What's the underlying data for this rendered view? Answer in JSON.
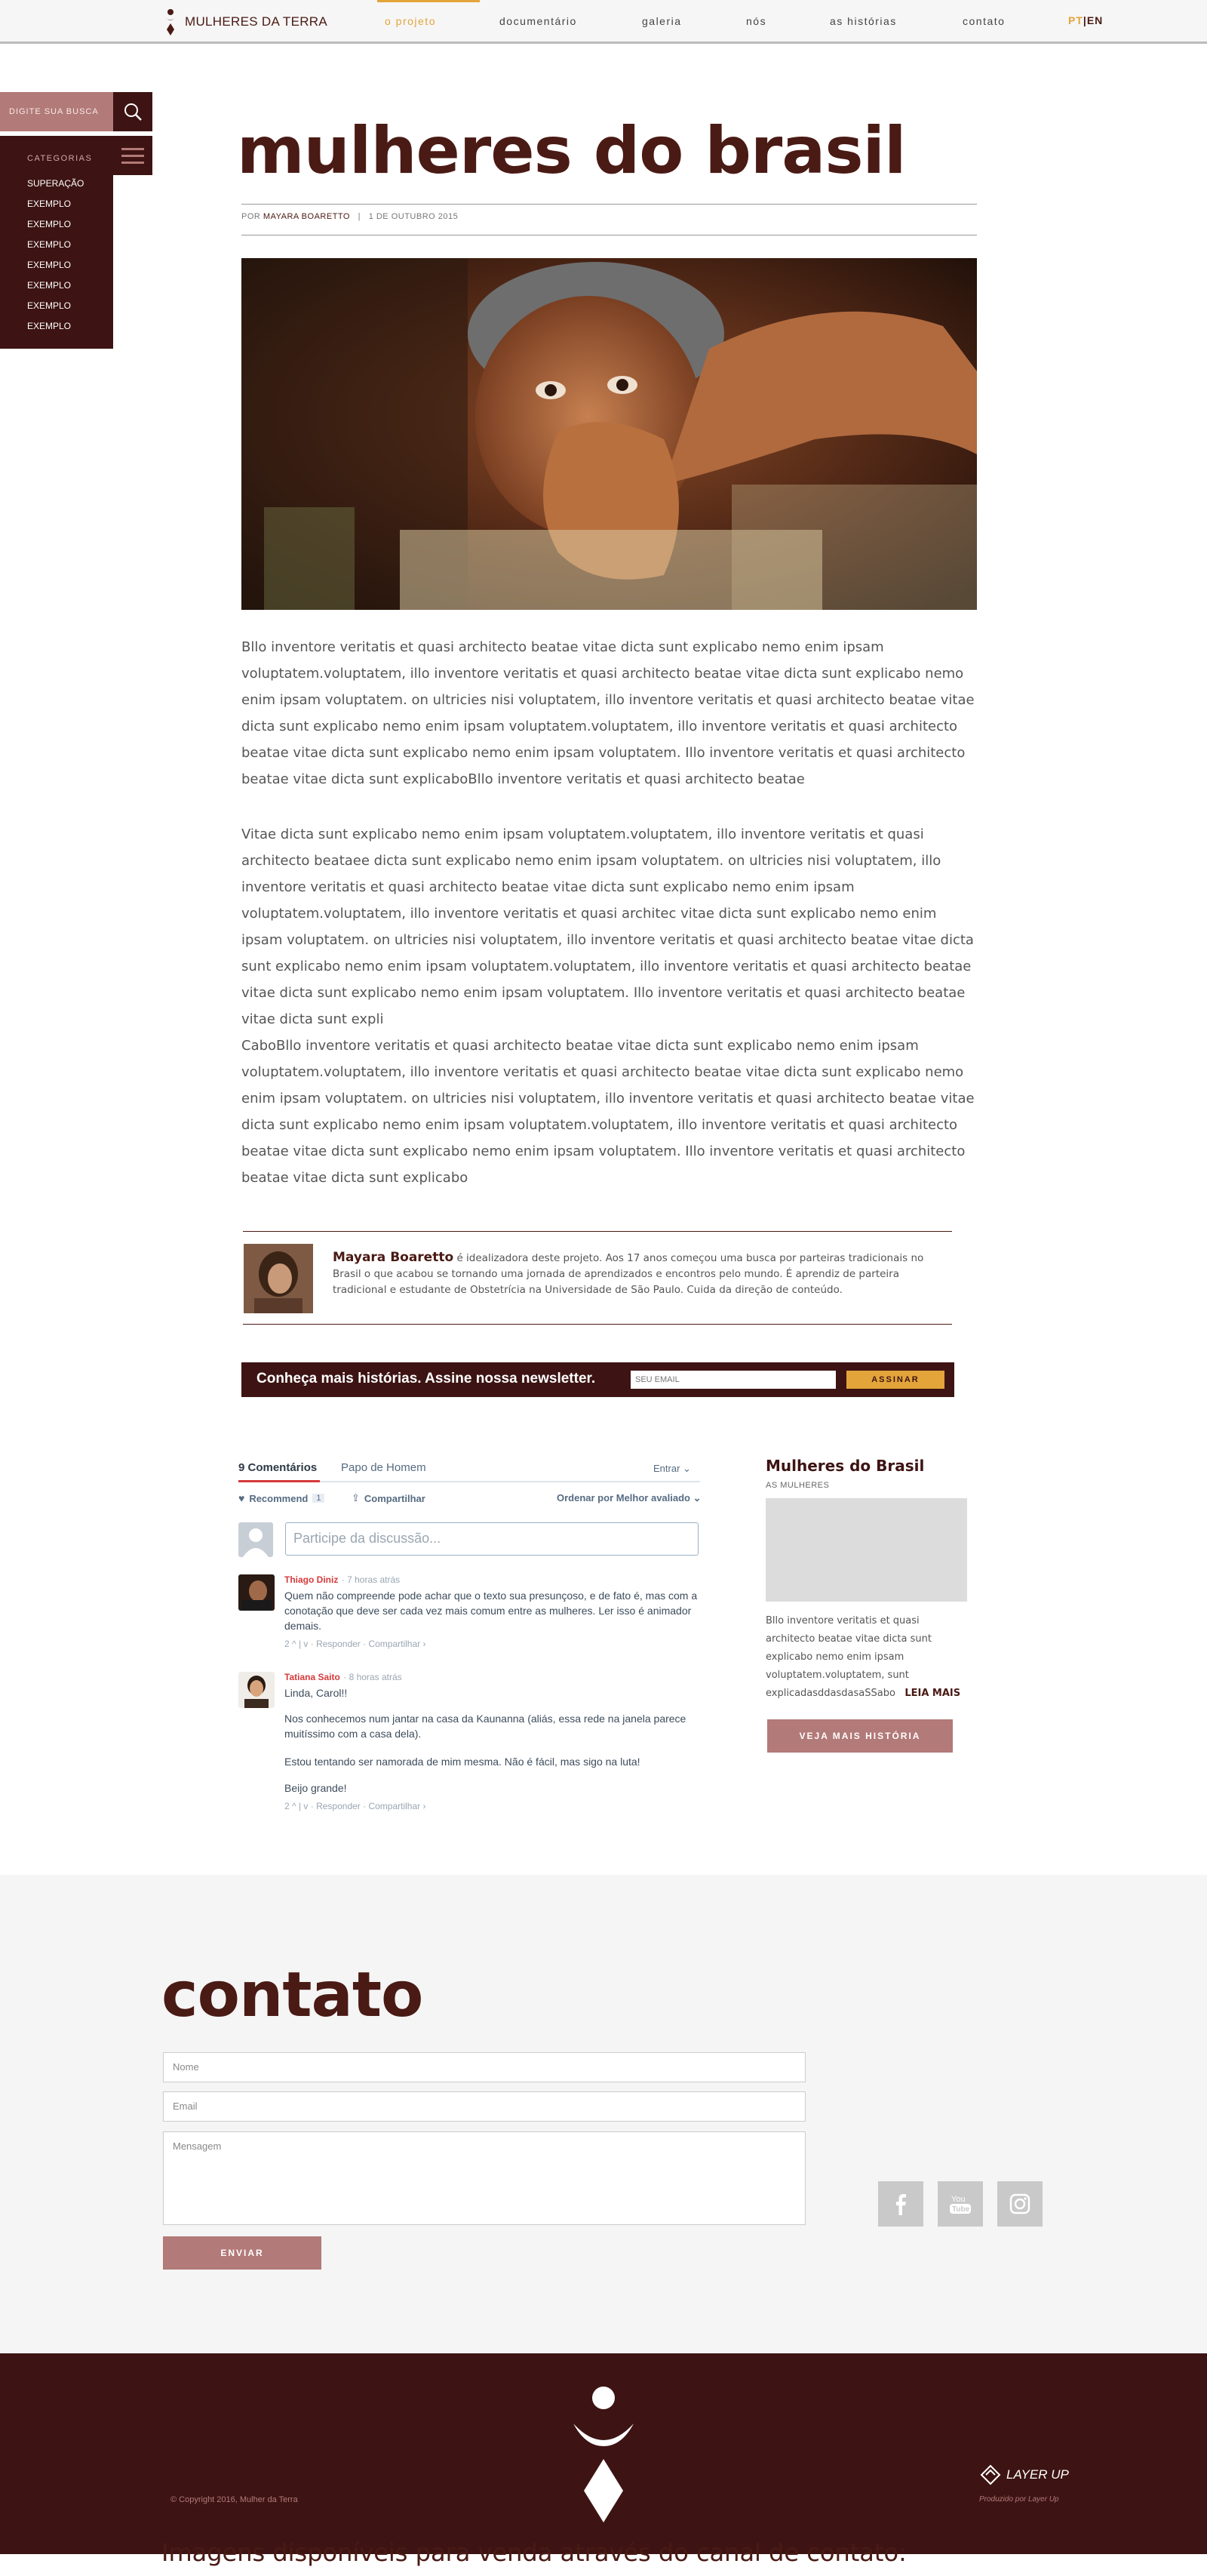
{
  "nav": {
    "logo_text": "MULHERES DA TERRA",
    "items": [
      "o projeto",
      "documentário",
      "galeria",
      "nós",
      "as histórias",
      "contato"
    ],
    "lang_pt": "PT",
    "lang_sep": "|",
    "lang_en": "EN",
    "accent_color": "#e3a43a"
  },
  "sidebar": {
    "search_placeholder": "DIGITE SUA BUSCA",
    "categories_header": "CATEGORIAS",
    "categories": [
      "SUPERAÇÃO",
      "EXEMPLO",
      "EXEMPLO",
      "EXEMPLO",
      "EXEMPLO",
      "EXEMPLO",
      "EXEMPLO",
      "EXEMPLO"
    ]
  },
  "article": {
    "title": "mulheres do brasil",
    "byline_prefix": "POR",
    "author": "MAYARA BOARETTO",
    "separator": "|",
    "date": "1 DE OUTUBRO 2015",
    "paragraphs": [
      "Bllo inventore veritatis et quasi architecto beatae vitae dicta sunt explicabo nemo enim ipsam voluptatem.voluptatem, illo inventore veritatis et quasi architecto beatae vitae dicta sunt explicabo nemo enim ipsam voluptatem. on ultricies nisi voluptatem, illo inventore veritatis et quasi architecto beatae vitae dicta sunt explicabo nemo enim ipsam voluptatem.voluptatem, illo inventore veritatis et quasi architecto beatae vitae dicta sunt explicabo nemo enim ipsam voluptatem. Illo inventore veritatis et quasi architecto beatae vitae dicta sunt explicaboBllo inventore veritatis et quasi architecto beatae",
      "Vitae dicta sunt explicabo nemo enim ipsam voluptatem.voluptatem, illo inventore veritatis et quasi architecto beataee dicta sunt explicabo nemo enim ipsam voluptatem. on ultricies nisi voluptatem, illo inventore veritatis et quasi architecto beatae vitae dicta sunt explicabo nemo enim ipsam voluptatem.voluptatem, illo inventore veritatis et quasi architec vitae dicta sunt explicabo nemo enim ipsam voluptatem. on ultricies nisi voluptatem, illo inventore veritatis et quasi architecto beatae vitae dicta sunt explicabo nemo enim ipsam voluptatem.voluptatem, illo inventore veritatis et quasi architecto beatae vitae dicta sunt explicabo nemo enim ipsam voluptatem. Illo inventore veritatis et quasi architecto beatae vitae dicta sunt expli",
      "CaboBllo inventore veritatis et quasi architecto beatae vitae dicta sunt explicabo nemo enim ipsam voluptatem.voluptatem, illo inventore veritatis et quasi architecto beatae vitae dicta sunt explicabo nemo enim ipsam voluptatem. on ultricies nisi voluptatem, illo inventore veritatis et quasi architecto beatae vitae dicta sunt explicabo nemo enim ipsam voluptatem.voluptatem, illo inventore veritatis et quasi architecto beatae vitae dicta sunt explicabo nemo enim ipsam voluptatem. Illo inventore veritatis et quasi architecto beatae vitae dicta sunt explicabo"
    ]
  },
  "author_box": {
    "name": "Mayara Boaretto",
    "bio": " é idealizadora deste projeto. Aos 17 anos começou uma busca por parteiras tradicionais no Brasil o que acabou se tornando uma jornada de aprendizados e encontros pelo mundo. É aprendiz de parteira tradicional e estudante de Obstetrícia na Universidade de São Paulo. Cuida da direção de conteúdo."
  },
  "newsletter": {
    "text": "Conheça mais histórias. Assine nossa newsletter.",
    "email_placeholder": "SEU EMAIL",
    "button": "ASSINAR"
  },
  "comments": {
    "tab_count": "9 Comentários",
    "tab_community": "Papo de Homem",
    "login": "Entrar ⌄",
    "recommend": "Recommend",
    "recommend_count": "1",
    "share": "Compartilhar",
    "sort": "Ordenar por Melhor avaliado ⌄",
    "input_placeholder": "Participe da discussão...",
    "items": [
      {
        "name": "Thiago Diniz",
        "time": "· 7 horas atrás",
        "body": [
          "Quem não compreende pode achar que o texto sua presunçoso, e de fato é, mas com a conotação que deve ser cada vez mais comum entre as mulheres. Ler isso é animador demais."
        ],
        "actions": "2 ^ | v · Responder · Compartilhar ›"
      },
      {
        "name": "Tatiana Saito",
        "time": "· 8 horas atrás",
        "body": [
          "Linda, Carol!!",
          "Nos conhecemos num jantar na casa da Kaunanna (aliás, essa rede na janela parece muitíssimo com a casa dela).",
          "Estou tentando ser namorada de mim mesma. Não é fácil, mas sigo na luta!",
          "Beijo grande!"
        ],
        "actions": "2 ^ | v · Responder · Compartilhar ›"
      }
    ]
  },
  "side_card": {
    "title": "Mulheres do Brasil",
    "subtitle": "AS MULHERES",
    "text": "Bllo inventore veritatis et quasi architecto beatae vitae dicta sunt explicabo nemo enim ipsam voluptatem.voluptatem, sunt explicadasddasdasaSSabo",
    "read_more": "LEIA MAIS",
    "button": "VEJA MAIS HISTÓRIA"
  },
  "contact": {
    "title": "contato",
    "name_placeholder": "Nome",
    "email_placeholder": "Email",
    "message_placeholder": "Mensagem",
    "send": "ENVIAR",
    "social": [
      "facebook-icon",
      "youtube-icon",
      "instagram-icon"
    ]
  },
  "footer": {
    "copyright": "© Copyright 2016, Mulher da Terra",
    "producer_logo": "LAYER UP",
    "produced_by": "Produzido por Layer Up",
    "bottom_text": "Imagens  disponíveis para venda através do canal de contato:"
  }
}
